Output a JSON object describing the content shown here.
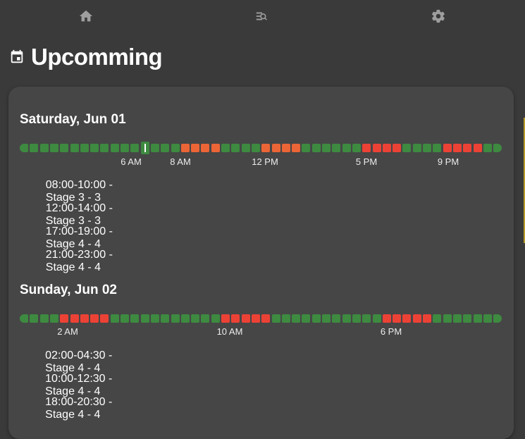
{
  "nav": {
    "items": [
      "home-icon",
      "search-list-icon",
      "gear-icon"
    ]
  },
  "page": {
    "title": "Upcomming",
    "icon": "calendar-icon"
  },
  "colors": {
    "ok": "#3d8a40",
    "stage3": "#ec6536",
    "stage4": "#ec4236",
    "background": "#3a3a3a",
    "card": "#464646"
  },
  "days": [
    {
      "title": "Saturday, Jun 01",
      "timeline": {
        "slot_minutes": 30,
        "current_slot": 12,
        "outages": [
          {
            "start": 16,
            "end": 20,
            "stage": 3
          },
          {
            "start": 24,
            "end": 28,
            "stage": 3
          },
          {
            "start": 34,
            "end": 38,
            "stage": 4
          },
          {
            "start": 42,
            "end": 46,
            "stage": 4
          }
        ],
        "ticks": [
          {
            "label": "6 AM",
            "slot": 12
          },
          {
            "label": "8 AM",
            "slot": 16
          },
          {
            "label": "12 PM",
            "slot": 24
          },
          {
            "label": "5 PM",
            "slot": 34
          },
          {
            "label": "9 PM",
            "slot": 42
          }
        ]
      },
      "events": [
        {
          "text": "08:00-10:00 - Stage 3 - 3",
          "stage": 3
        },
        {
          "text": "12:00-14:00 - Stage 3 - 3",
          "stage": 3
        },
        {
          "text": "17:00-19:00 - Stage 4 - 4",
          "stage": 4
        },
        {
          "text": "21:00-23:00 - Stage 4 - 4",
          "stage": 4
        }
      ]
    },
    {
      "title": "Sunday, Jun 02",
      "timeline": {
        "slot_minutes": 30,
        "current_slot": null,
        "outages": [
          {
            "start": 4,
            "end": 9,
            "stage": 4
          },
          {
            "start": 20,
            "end": 25,
            "stage": 4
          },
          {
            "start": 36,
            "end": 41,
            "stage": 4
          }
        ],
        "ticks": [
          {
            "label": "2 AM",
            "slot": 4
          },
          {
            "label": "10 AM",
            "slot": 20
          },
          {
            "label": "6 PM",
            "slot": 36
          }
        ]
      },
      "events": [
        {
          "text": "02:00-04:30 - Stage 4 - 4",
          "stage": 4
        },
        {
          "text": "10:00-12:30 - Stage 4 - 4",
          "stage": 4
        },
        {
          "text": "18:00-20:30 - Stage 4 - 4",
          "stage": 4
        }
      ]
    }
  ]
}
